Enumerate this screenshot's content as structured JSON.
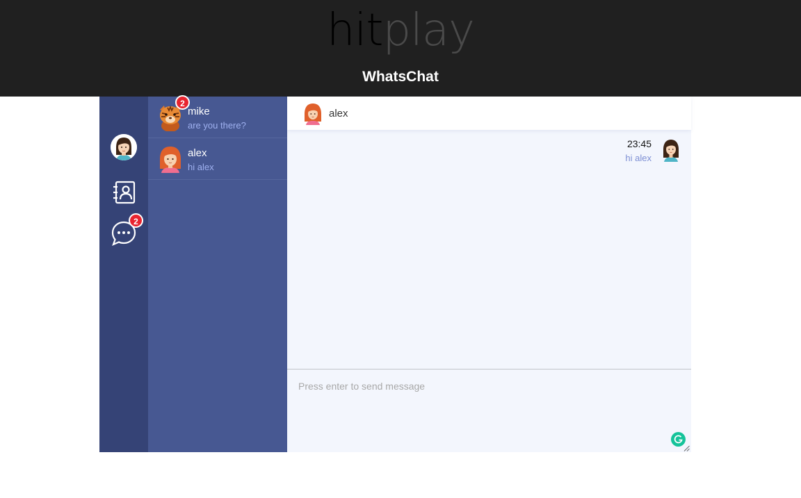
{
  "brand": {
    "logo_part1": "hit",
    "logo_part2": "play",
    "app_title": "WhatsChat"
  },
  "rail": {
    "profile_avatar": "profile-avatar-icon",
    "contacts_icon": "contacts-icon",
    "chats_icon": "chat-bubble-icon",
    "chats_badge": "2"
  },
  "conversations": [
    {
      "name": "mike",
      "preview": "are you there?",
      "badge": "2",
      "avatar": "tiger-avatar-icon"
    },
    {
      "name": "alex",
      "preview": "hi alex",
      "avatar": "red-hair-girl-avatar-icon"
    }
  ],
  "chat": {
    "contact_name": "alex",
    "messages": [
      {
        "time": "23:45",
        "text": "hi alex",
        "avatar": "brown-hair-girl-avatar-icon"
      }
    ],
    "composer_placeholder": "Press enter to send message"
  },
  "colors": {
    "topbar": "#202020",
    "rail": "#354376",
    "conversation_list": "#475892",
    "chat_bg": "#f3f6fd",
    "badge": "#e8242f",
    "preview_text": "#9fb1f0",
    "grammarly": "#15c39a"
  }
}
